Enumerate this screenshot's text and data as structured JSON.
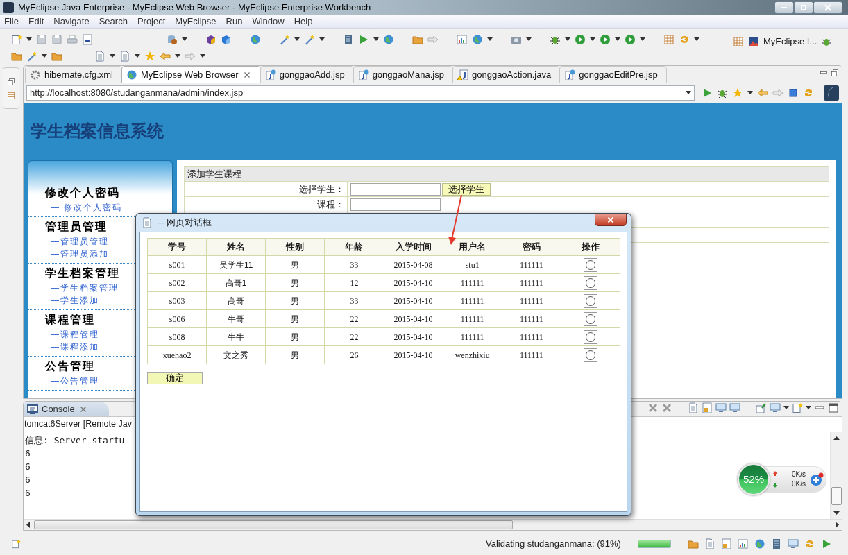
{
  "window": {
    "title": "MyEclipse Java Enterprise - MyEclipse Web Browser - MyEclipse Enterprise Workbench"
  },
  "menu": [
    "File",
    "Edit",
    "Navigate",
    "Search",
    "Project",
    "MyEclipse",
    "Run",
    "Window",
    "Help"
  ],
  "perspective": {
    "label": "MyEclipse I..."
  },
  "editor_tabs": [
    {
      "label": "hibernate.cfg.xml",
      "kind": "xml",
      "selected": false
    },
    {
      "label": "MyEclipse Web Browser",
      "kind": "browser",
      "selected": true
    },
    {
      "label": "gonggaoAdd.jsp",
      "kind": "jsp",
      "selected": false
    },
    {
      "label": "gonggaoMana.jsp",
      "kind": "jsp",
      "selected": false
    },
    {
      "label": "gonggaoAction.java",
      "kind": "java",
      "selected": false
    },
    {
      "label": "gonggaoEditPre.jsp",
      "kind": "jsp",
      "selected": false
    }
  ],
  "browser": {
    "url": "http://localhost:8080/studanganmana/admin/index.jsp"
  },
  "web_page": {
    "site_title": "学生档案信息系统",
    "sidebar": [
      {
        "heading": "修改个人密码",
        "links": [
          "— 修改个人密码"
        ]
      },
      {
        "heading": "管理员管理",
        "links": [
          "—管理员管理",
          "—管理员添加"
        ]
      },
      {
        "heading": "学生档案管理",
        "links": [
          "—学生档案管理",
          "—学生添加"
        ]
      },
      {
        "heading": "课程管理",
        "links": [
          "—课程管理",
          "—课程添加"
        ]
      },
      {
        "heading": "公告管理",
        "links": [
          "—公告管理"
        ]
      }
    ],
    "form": {
      "title": "添加学生课程",
      "rows": [
        {
          "kind": "picker",
          "label": "选择学生：",
          "button": "选择学生"
        },
        {
          "kind": "input",
          "label": "课程："
        },
        {
          "kind": "blank"
        },
        {
          "kind": "blank"
        }
      ]
    }
  },
  "dialog": {
    "title": "-- 网页对话框",
    "columns": [
      "学号",
      "姓名",
      "性别",
      "年龄",
      "入学时间",
      "用户名",
      "密码",
      "操作"
    ],
    "rows": [
      {
        "cells": [
          "s001",
          "吴学生11",
          "男",
          "33",
          "2015-04-08",
          "stu1",
          "111111"
        ],
        "selected": false
      },
      {
        "cells": [
          "s002",
          "高哥1",
          "男",
          "12",
          "2015-04-10",
          "111111",
          "111111"
        ],
        "selected": false
      },
      {
        "cells": [
          "s003",
          "高哥",
          "男",
          "33",
          "2015-04-10",
          "111111",
          "111111"
        ],
        "selected": false
      },
      {
        "cells": [
          "s006",
          "牛哥",
          "男",
          "22",
          "2015-04-10",
          "111111",
          "111111"
        ],
        "selected": false
      },
      {
        "cells": [
          "s008",
          "牛牛",
          "男",
          "22",
          "2015-04-10",
          "111111",
          "111111"
        ],
        "selected": false
      },
      {
        "cells": [
          "xuehao2",
          "文之秀",
          "男",
          "26",
          "2015-04-10",
          "wenzhixiu",
          "111111"
        ],
        "selected": false
      }
    ],
    "ok_button": "确定"
  },
  "console": {
    "tab": "Console",
    "process": "tomcat6Server [Remote Jav",
    "lines": [
      "信息: Server startu",
      "6",
      "6",
      "6",
      "6"
    ]
  },
  "speed_widget": {
    "percent": "52%",
    "upload": "0K/s",
    "download": "0K/s"
  },
  "status_bar": {
    "message": "Validating studanganmana: (91%)",
    "level": 1
  }
}
